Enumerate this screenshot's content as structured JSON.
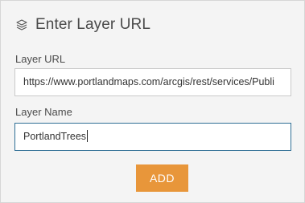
{
  "header": {
    "icon": "layers-icon",
    "title": "Enter Layer URL"
  },
  "form": {
    "layer_url_label": "Layer URL",
    "layer_url_value": "https://www.portlandmaps.com/arcgis/rest/services/Publi",
    "layer_name_label": "Layer Name",
    "layer_name_value": "PortlandTrees"
  },
  "actions": {
    "add_label": "ADD"
  },
  "colors": {
    "panel_background": "#f4f4f4",
    "add_button": "#e8963a",
    "focused_border": "#2f6f95"
  }
}
